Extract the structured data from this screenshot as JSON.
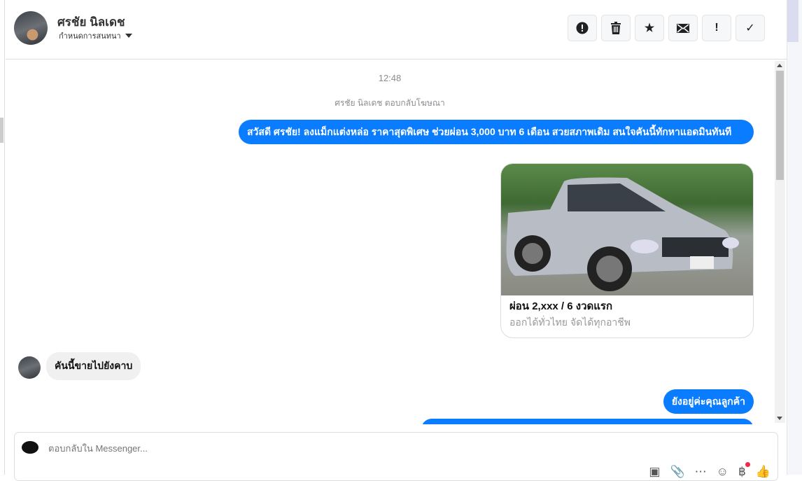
{
  "header": {
    "name": "ศรชัย นิลเดช",
    "subtitle": "กำหนดการสนทนา",
    "actions": [
      {
        "icon": "alert-circle-icon",
        "glyph": "⓿"
      },
      {
        "icon": "trash-icon",
        "glyph": "🗑"
      },
      {
        "icon": "star-icon",
        "glyph": "★"
      },
      {
        "icon": "envelope-icon",
        "glyph": "✉"
      },
      {
        "icon": "exclamation-icon",
        "glyph": "!"
      },
      {
        "icon": "check-icon",
        "glyph": "✓"
      }
    ]
  },
  "thread": {
    "time": "12:48",
    "note": "ศรชัย นิลเดช ตอบกลับโฆษณา",
    "msg1": "สวัสดี ศรชัย! ลงแม็กแต่งหล่อ ราคาสุดพิเศษ ช่วยผ่อน 3,000 บาท 6 เดือน สวยสภาพเดิม สนใจคันนี้ทักหาแอดมินทันที",
    "card": {
      "title": "ผ่อน 2,xxx / 6 งวดแรก",
      "subtitle": "ออกได้ทั่วไทย จัดได้ทุกอาชีพ"
    },
    "incoming": "คันนี้ขายไปยังคาบ",
    "msg2": "ยังอยู่ค่ะคุณลูกค้า"
  },
  "composer": {
    "placeholder": "ตอบกลับใน Messenger..."
  },
  "colors": {
    "accent": "#0a7cff"
  }
}
